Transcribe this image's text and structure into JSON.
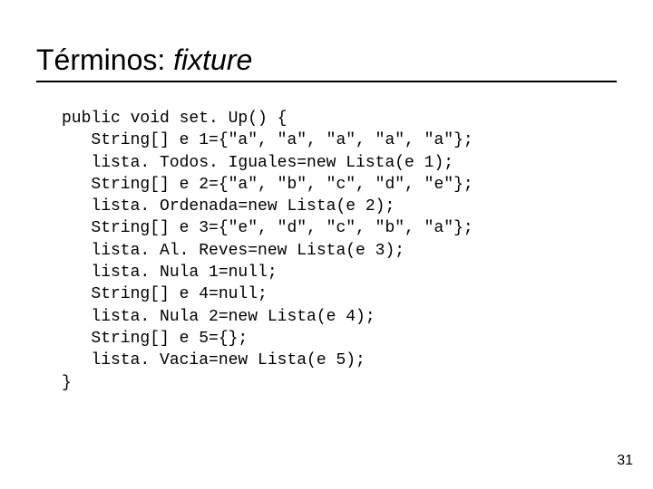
{
  "title": {
    "prefix": "Términos: ",
    "italic": "fixture"
  },
  "code": {
    "l1": "public void set. Up() {",
    "l2": "   String[] e 1={\"a\", \"a\", \"a\", \"a\", \"a\"};",
    "l3": "   lista. Todos. Iguales=new Lista(e 1);",
    "l4": "   String[] e 2={\"a\", \"b\", \"c\", \"d\", \"e\"};",
    "l5": "   lista. Ordenada=new Lista(e 2);",
    "l6": "   String[] e 3={\"e\", \"d\", \"c\", \"b\", \"a\"};",
    "l7": "   lista. Al. Reves=new Lista(e 3);",
    "l8": "   lista. Nula 1=null;",
    "l9": "   String[] e 4=null;",
    "l10": "   lista. Nula 2=new Lista(e 4);",
    "l11": "   String[] e 5={};",
    "l12": "   lista. Vacia=new Lista(e 5);",
    "l13": "}"
  },
  "page_number": "31"
}
